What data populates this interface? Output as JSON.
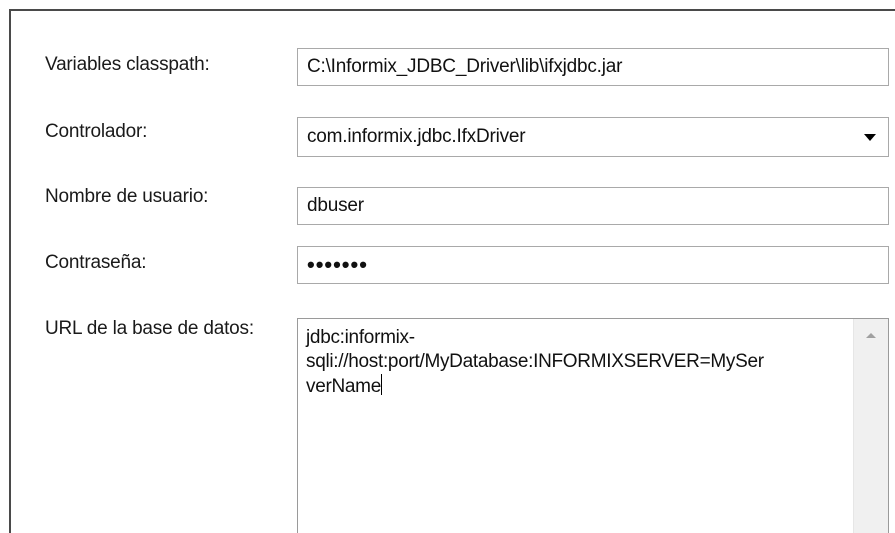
{
  "form": {
    "classpath": {
      "label": "Variables classpath:",
      "value": "C:\\Informix_JDBC_Driver\\lib\\ifxjdbc.jar"
    },
    "driver": {
      "label": "Controlador:",
      "value": "com.informix.jdbc.IfxDriver",
      "icon": "chevron-down-icon"
    },
    "username": {
      "label": "Nombre de usuario:",
      "value": "dbuser"
    },
    "password": {
      "label": "Contraseña:",
      "value": "•••••••"
    },
    "database_url": {
      "label": "URL de la base de datos:",
      "value": "jdbc:informix-\nsqli://host:port/MyDatabase:INFORMIXSERVER=MySer\nverName"
    }
  },
  "icons": {
    "scroll_up": "scroll-up-arrow-icon"
  },
  "colors": {
    "border": "#a9a9a9",
    "panel_edge": "#4a4a4a",
    "scrollbar": "#f0f0f0"
  }
}
